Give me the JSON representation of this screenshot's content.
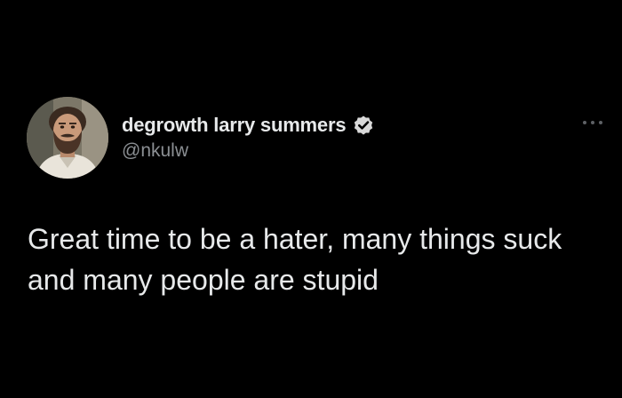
{
  "tweet": {
    "author": {
      "display_name": "degrowth larry summers",
      "handle": "@nkulw",
      "verified": true,
      "verified_icon": "verified-badge-icon",
      "avatar_icon": "profile-photo"
    },
    "more_icon": "more-options-icon",
    "text": "Great time to be a hater, many things suck and many people are stupid"
  },
  "colors": {
    "background": "#000000",
    "primary_text": "#e7e9ea",
    "secondary_text": "#8b8f93",
    "badge": "#d9d9d9"
  }
}
